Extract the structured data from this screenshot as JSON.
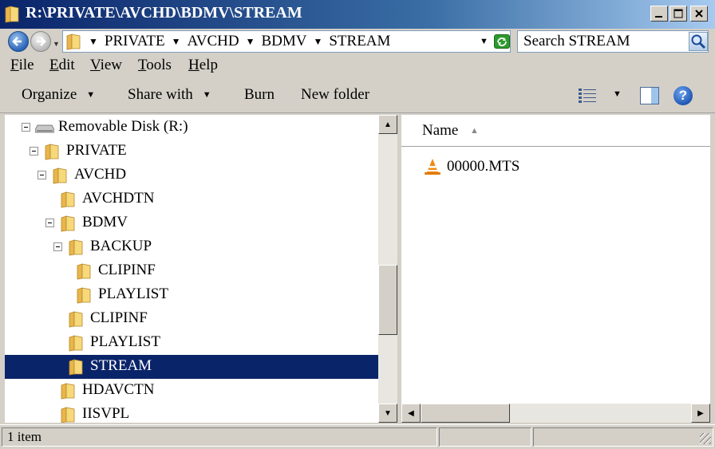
{
  "window": {
    "title": "R:\\PRIVATE\\AVCHD\\BDMV\\STREAM"
  },
  "address": {
    "crumbs": [
      "PRIVATE",
      "AVCHD",
      "BDMV",
      "STREAM"
    ],
    "search_placeholder": "Search STREAM"
  },
  "menu": {
    "items": [
      {
        "label": "File",
        "key": "F",
        "rest": "ile"
      },
      {
        "label": "Edit",
        "key": "E",
        "rest": "dit"
      },
      {
        "label": "View",
        "key": "V",
        "rest": "iew"
      },
      {
        "label": "Tools",
        "key": "T",
        "rest": "ools"
      },
      {
        "label": "Help",
        "key": "H",
        "rest": "elp"
      }
    ]
  },
  "toolbar": {
    "organize": "Organize",
    "share_with": "Share with",
    "burn": "Burn",
    "new_folder": "New folder"
  },
  "tree": {
    "items": [
      {
        "label": "Removable Disk (R:)",
        "icon": "drive-icon",
        "expanded": true,
        "selected": false
      },
      {
        "label": "PRIVATE",
        "icon": "folder-icon",
        "expanded": true,
        "selected": false
      },
      {
        "label": "AVCHD",
        "icon": "folder-icon",
        "expanded": true,
        "selected": false
      },
      {
        "label": "AVCHDTN",
        "icon": "folder-icon",
        "expanded": false,
        "selected": false
      },
      {
        "label": "BDMV",
        "icon": "folder-icon",
        "expanded": true,
        "selected": false
      },
      {
        "label": "BACKUP",
        "icon": "folder-icon",
        "expanded": true,
        "selected": false
      },
      {
        "label": "CLIPINF",
        "icon": "folder-icon",
        "expanded": false,
        "selected": false
      },
      {
        "label": "PLAYLIST",
        "icon": "folder-icon",
        "expanded": false,
        "selected": false
      },
      {
        "label": "CLIPINF",
        "icon": "folder-icon",
        "expanded": false,
        "selected": false
      },
      {
        "label": "PLAYLIST",
        "icon": "folder-icon",
        "expanded": false,
        "selected": false
      },
      {
        "label": "STREAM",
        "icon": "folder-icon",
        "expanded": false,
        "selected": true
      },
      {
        "label": "HDAVCTN",
        "icon": "folder-icon",
        "expanded": false,
        "selected": false
      },
      {
        "label": "IISVPL",
        "icon": "folder-icon",
        "expanded": false,
        "selected": false
      }
    ]
  },
  "files": {
    "column_name": "Name",
    "items": [
      {
        "name": "00000.MTS",
        "icon": "vlc-icon"
      }
    ]
  },
  "status": {
    "text": "1 item"
  },
  "colors": {
    "selection": "#0a246a",
    "window_face": "#d4d0c8"
  }
}
